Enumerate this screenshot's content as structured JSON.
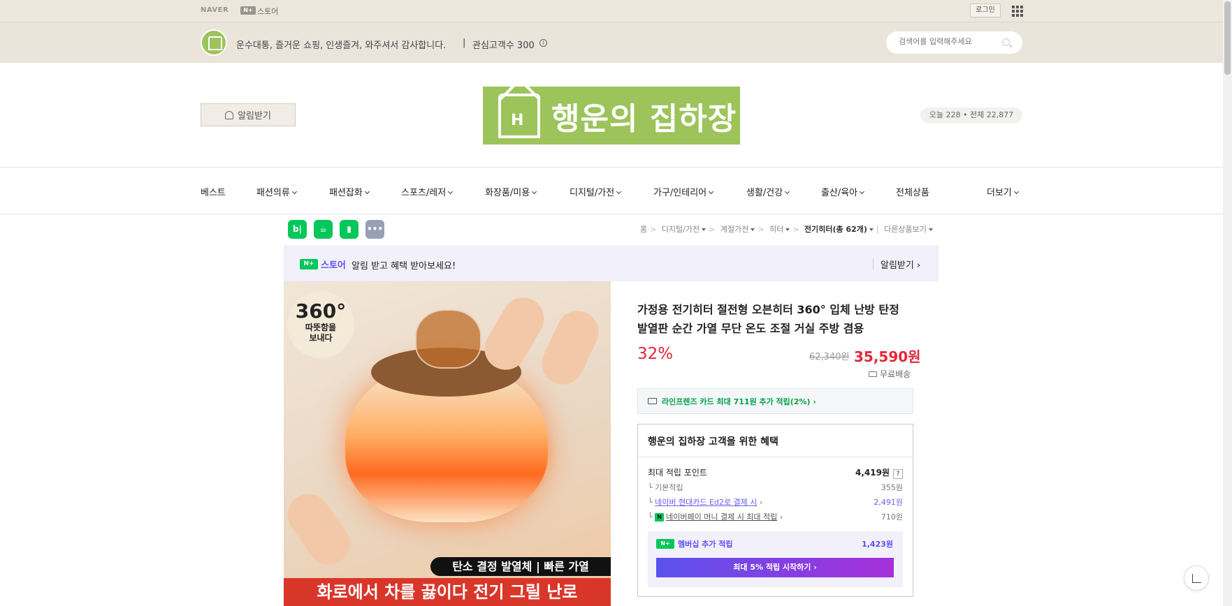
{
  "gnb": {
    "naver": "NAVER",
    "nplus": "N+",
    "store": "스토어",
    "login": "로그인",
    "apps_icon": "grid-icon"
  },
  "store_header": {
    "slogan": "운수대통, 즐거운 쇼핑, 인생즐겨, 와주셔서 감사합니다.",
    "separator": "|",
    "fav_customers": "관심고객수 300",
    "search_placeholder": "검색어를 입력해주세요"
  },
  "banner": {
    "alarm_label": "알림받기",
    "store_name": "행운의 집하장",
    "logo_initial": "H",
    "visit_count": "오늘 228 • 전체 22,877"
  },
  "categories": [
    {
      "label": "베스트",
      "dropdown": false
    },
    {
      "label": "패션의류",
      "dropdown": true
    },
    {
      "label": "패션잡화",
      "dropdown": true
    },
    {
      "label": "스포츠/레저",
      "dropdown": true
    },
    {
      "label": "화장품/미용",
      "dropdown": true
    },
    {
      "label": "디지털/가전",
      "dropdown": true
    },
    {
      "label": "가구/인테리어",
      "dropdown": true
    },
    {
      "label": "생활/건강",
      "dropdown": true
    },
    {
      "label": "출산/육아",
      "dropdown": true
    },
    {
      "label": "전체상품",
      "dropdown": false
    },
    {
      "label": "더보기",
      "dropdown": true
    }
  ],
  "share_icons": [
    {
      "name": "blog-share-icon",
      "glyph": "b|",
      "color": "#03c75a"
    },
    {
      "name": "cafe-share-icon",
      "glyph": "☕",
      "color": "#03c75a"
    },
    {
      "name": "bookmark-share-icon",
      "glyph": "▮",
      "color": "#03c75a"
    },
    {
      "name": "more-share-icon",
      "glyph": "•••",
      "color": "#9aa0b4"
    }
  ],
  "breadcrumb": {
    "home": "홈",
    "items": [
      "디지털/가전",
      "계절가전",
      "히터"
    ],
    "current": "전기히터(총 62개)",
    "other": "다른상품보기"
  },
  "nstore_banner": {
    "badge": "N+",
    "store": "스토어",
    "text": "알림 받고 혜택 받아보세요!",
    "alarm": "알림받기 ›"
  },
  "product_image": {
    "badge_big": "360°",
    "badge_line1": "따뜻함을",
    "badge_line2": "보내다",
    "caption1": "탄소 결정 발열체 | 빠른 가열",
    "caption2": "화로에서 차를 끓이다 전기 그릴 난로"
  },
  "product": {
    "title": "가정용 전기히터 절전형 오븐히터 360° 입체 난방 탄정 발열판 순간 가열 무단 온도 조절 거실 주방 겸용",
    "discount": "32%",
    "original_price": "62,340원",
    "sale_price": "35,590원",
    "shipping": "무료배송",
    "card_offer": "라인프렌즈 카드 최대 711원 추가 적립(2%) ›"
  },
  "benefits": {
    "title": "행운의 집하장 고객을 위한 혜택",
    "max_points_label": "최대 적립 포인트",
    "max_points_value": "4,419원",
    "help": "?",
    "basic_label": "기본적립",
    "basic_value": "355원",
    "hyundai_label": "네이버 현대카드 Ed2로 결제 시",
    "hyundai_value": "2,491원",
    "npay_label": "네이버페이 머니 결제 시 최대 적립",
    "npay_value": "710원",
    "npay_badge": "N",
    "member_badge": "N+",
    "member_label": "멤버십 추가 적립",
    "member_value": "1,423원",
    "member_button": "최대 5% 적립 시작하기 ›"
  }
}
